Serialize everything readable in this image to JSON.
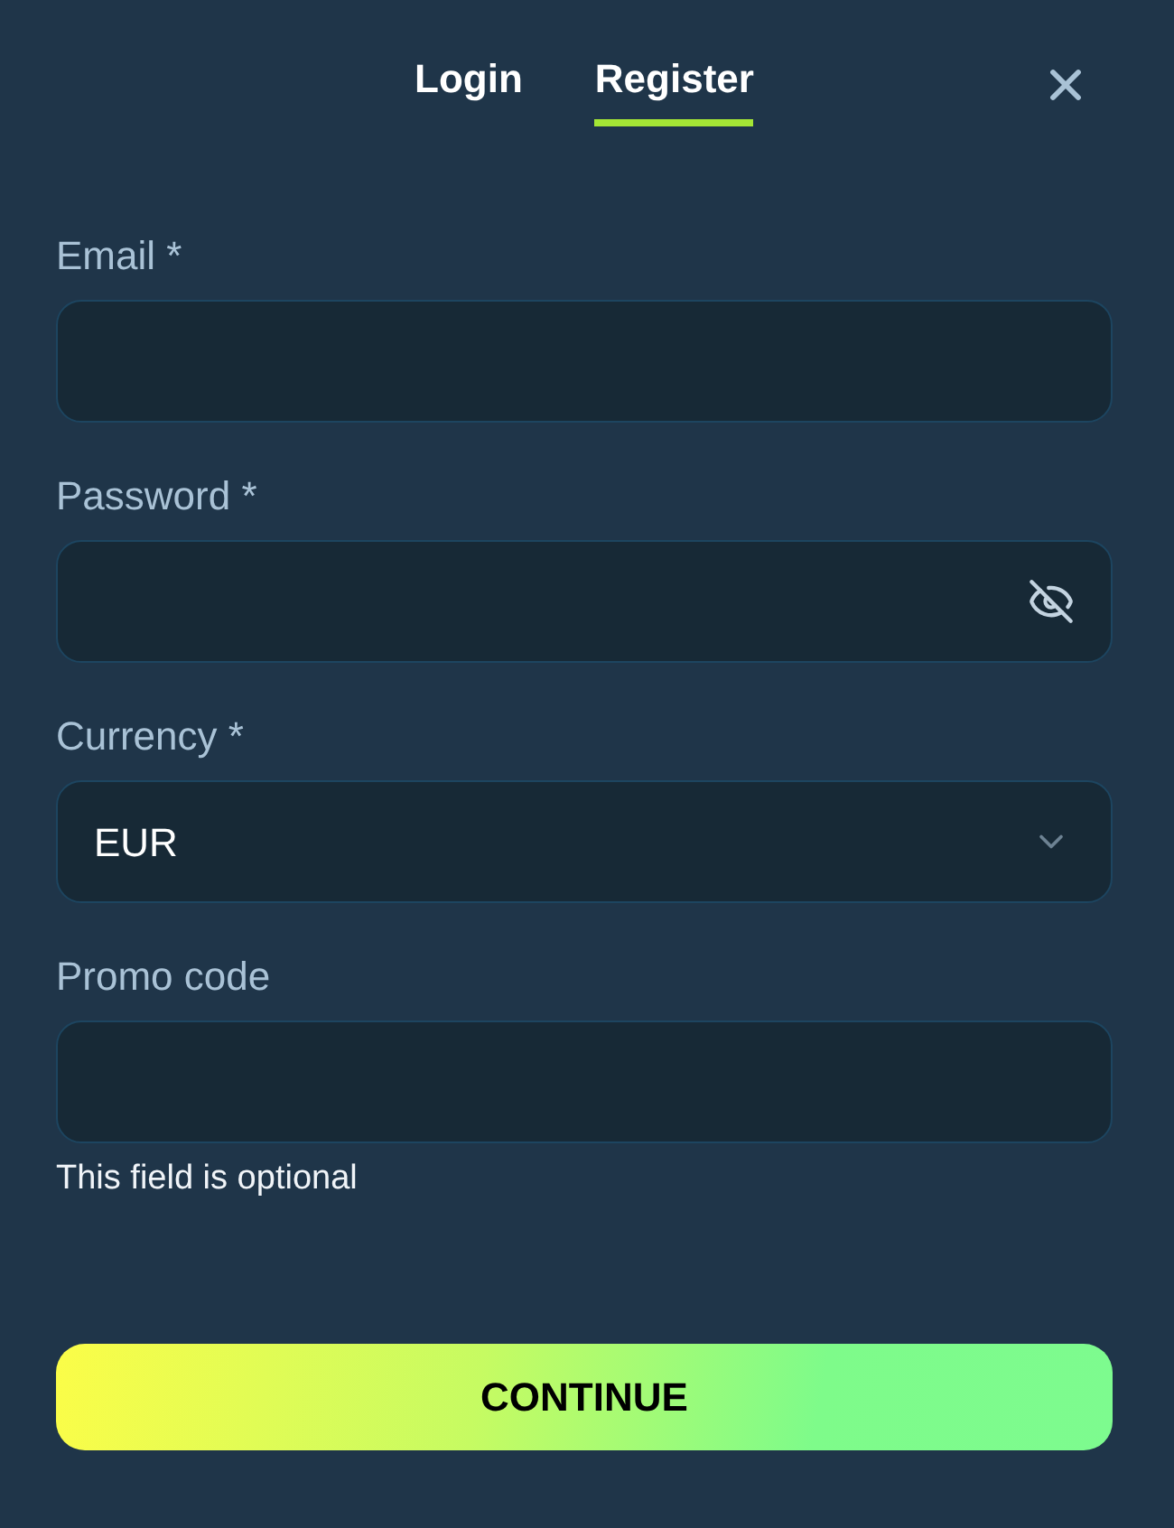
{
  "tabs": [
    {
      "label": "Login",
      "selected": false
    },
    {
      "label": "Register",
      "selected": true
    }
  ],
  "fields": [
    {
      "kind": "text",
      "label": "Email *"
    },
    {
      "kind": "password",
      "label": "Password *"
    },
    {
      "kind": "select",
      "label": "Currency *",
      "value": "EUR"
    },
    {
      "kind": "text",
      "label": "Promo code",
      "hint": "This field is optional"
    }
  ],
  "button": {
    "label": "CONTINUE"
  }
}
